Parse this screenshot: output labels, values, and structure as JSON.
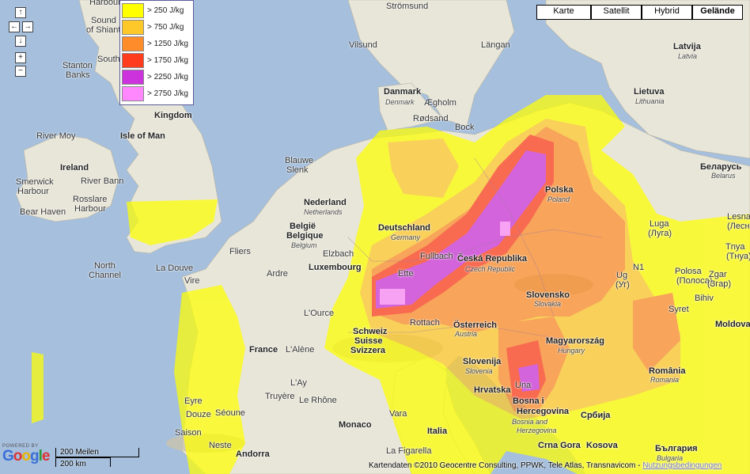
{
  "map_type_buttons": [
    {
      "label": "Karte",
      "active": false
    },
    {
      "label": "Satellit",
      "active": false
    },
    {
      "label": "Hybrid",
      "active": false
    },
    {
      "label": "Gelände",
      "active": true
    }
  ],
  "nav": {
    "up": "↑",
    "left": "←",
    "right": "→",
    "down": "↓",
    "zoom_in": "+",
    "zoom_out": "−"
  },
  "legend": [
    {
      "label": "> 250 J/kg",
      "color": "#ffff00"
    },
    {
      "label": "> 750 J/kg",
      "color": "#ffc82a"
    },
    {
      "label": "> 1250 J/kg",
      "color": "#ff8c2a"
    },
    {
      "label": "> 1750 J/kg",
      "color": "#ff3c1e"
    },
    {
      "label": "> 2250 J/kg",
      "color": "#cc33dd"
    },
    {
      "label": "> 2750 J/kg",
      "color": "#ff88ff"
    }
  ],
  "places": [
    {
      "name": "Harbour",
      "cls": ""
    },
    {
      "name": "Sound",
      "cls": ""
    },
    {
      "name": "of Shiant",
      "cls": ""
    },
    {
      "name": "South",
      "cls": ""
    },
    {
      "name": "Stanton",
      "cls": ""
    },
    {
      "name": "Banks",
      "cls": ""
    },
    {
      "name": "Kingdom",
      "cls": "country"
    },
    {
      "name": "River Moy",
      "cls": ""
    },
    {
      "name": "Isle of Man",
      "cls": "country"
    },
    {
      "name": "Ireland",
      "cls": "country"
    },
    {
      "name": "River Bann",
      "cls": ""
    },
    {
      "name": "Smerwick",
      "cls": ""
    },
    {
      "name": "Harbour",
      "cls": ""
    },
    {
      "name": "Rosslare",
      "cls": ""
    },
    {
      "name": "Harbour",
      "cls": ""
    },
    {
      "name": "Bear Haven",
      "cls": ""
    },
    {
      "name": "North",
      "cls": ""
    },
    {
      "name": "Channel",
      "cls": ""
    },
    {
      "name": "La Douve",
      "cls": ""
    },
    {
      "name": "Vire",
      "cls": ""
    },
    {
      "name": "Fliers",
      "cls": ""
    },
    {
      "name": "Ardre",
      "cls": ""
    },
    {
      "name": "L'Ource",
      "cls": ""
    },
    {
      "name": "France",
      "cls": "country"
    },
    {
      "name": "L'Alène",
      "cls": ""
    },
    {
      "name": "L'Ay",
      "cls": ""
    },
    {
      "name": "Truyère",
      "cls": ""
    },
    {
      "name": "Eyre",
      "cls": ""
    },
    {
      "name": "Douze",
      "cls": ""
    },
    {
      "name": "Séoune",
      "cls": ""
    },
    {
      "name": "Saison",
      "cls": ""
    },
    {
      "name": "Neste",
      "cls": ""
    },
    {
      "name": "Andorra",
      "cls": "country"
    },
    {
      "name": "Le Rhône",
      "cls": ""
    },
    {
      "name": "Monaco",
      "cls": "country"
    },
    {
      "name": "Strömsund",
      "cls": ""
    },
    {
      "name": "Vilsund",
      "cls": ""
    },
    {
      "name": "Längan",
      "cls": ""
    },
    {
      "name": "Danmark",
      "cls": "country"
    },
    {
      "name": "Denmark",
      "cls": "sub"
    },
    {
      "name": "Ægholm",
      "cls": ""
    },
    {
      "name": "Rødsand",
      "cls": ""
    },
    {
      "name": "Bock",
      "cls": ""
    },
    {
      "name": "Blauwe",
      "cls": ""
    },
    {
      "name": "Slenk",
      "cls": ""
    },
    {
      "name": "Nederland",
      "cls": "country"
    },
    {
      "name": "Netherlands",
      "cls": "sub"
    },
    {
      "name": "België",
      "cls": "country"
    },
    {
      "name": "Belgique",
      "cls": "country"
    },
    {
      "name": "Belgium",
      "cls": "sub"
    },
    {
      "name": "Elzbach",
      "cls": ""
    },
    {
      "name": "Luxembourg",
      "cls": "country"
    },
    {
      "name": "Deutschland",
      "cls": "country"
    },
    {
      "name": "Germany",
      "cls": "sub"
    },
    {
      "name": "Fullbach",
      "cls": ""
    },
    {
      "name": "Ette",
      "cls": ""
    },
    {
      "name": "Rottach",
      "cls": ""
    },
    {
      "name": "Schweiz",
      "cls": "country"
    },
    {
      "name": "Suisse",
      "cls": "country"
    },
    {
      "name": "Svizzera",
      "cls": "country"
    },
    {
      "name": "Österreich",
      "cls": "country"
    },
    {
      "name": "Austria",
      "cls": "sub"
    },
    {
      "name": "Česká Republika",
      "cls": "country"
    },
    {
      "name": "Czech Republic",
      "cls": "sub"
    },
    {
      "name": "Polska",
      "cls": "country"
    },
    {
      "name": "Poland",
      "cls": "sub"
    },
    {
      "name": "Slovensko",
      "cls": "country"
    },
    {
      "name": "Slovakia",
      "cls": "sub"
    },
    {
      "name": "Magyarország",
      "cls": "country"
    },
    {
      "name": "Hungary",
      "cls": "sub"
    },
    {
      "name": "Slovenija",
      "cls": "country"
    },
    {
      "name": "Slovenia",
      "cls": "sub"
    },
    {
      "name": "Hrvatska",
      "cls": "country"
    },
    {
      "name": "Una",
      "cls": ""
    },
    {
      "name": "Bosna i",
      "cls": "country"
    },
    {
      "name": "Hercegovina",
      "cls": "country"
    },
    {
      "name": "Bosnia and",
      "cls": "sub"
    },
    {
      "name": "Herzegovina",
      "cls": "sub"
    },
    {
      "name": "Србија",
      "cls": "country"
    },
    {
      "name": "Crna Gora",
      "cls": "country"
    },
    {
      "name": "Kosova",
      "cls": "country"
    },
    {
      "name": "Italia",
      "cls": "country"
    },
    {
      "name": "Vara",
      "cls": ""
    },
    {
      "name": "La Figarella",
      "cls": ""
    },
    {
      "name": "Latvija",
      "cls": "country"
    },
    {
      "name": "Latvia",
      "cls": "sub"
    },
    {
      "name": "Lietuva",
      "cls": "country"
    },
    {
      "name": "Lithuania",
      "cls": "sub"
    },
    {
      "name": "Беларусь",
      "cls": "country"
    },
    {
      "name": "Belarus",
      "cls": "sub"
    },
    {
      "name": "Luga",
      "cls": ""
    },
    {
      "name": "(Луга)",
      "cls": ""
    },
    {
      "name": "Lesna",
      "cls": ""
    },
    {
      "name": "(Лесна)",
      "cls": ""
    },
    {
      "name": "Tnya",
      "cls": ""
    },
    {
      "name": "(Тнуа)",
      "cls": ""
    },
    {
      "name": "Polosa",
      "cls": ""
    },
    {
      "name": "(Полоса)",
      "cls": ""
    },
    {
      "name": "Zgar",
      "cls": ""
    },
    {
      "name": "(Згар)",
      "cls": ""
    },
    {
      "name": "Ug",
      "cls": ""
    },
    {
      "name": "(Уг)",
      "cls": ""
    },
    {
      "name": "N1",
      "cls": ""
    },
    {
      "name": "Bihiv",
      "cls": ""
    },
    {
      "name": "Syret",
      "cls": ""
    },
    {
      "name": "Moldova",
      "cls": "country"
    },
    {
      "name": "România",
      "cls": "country"
    },
    {
      "name": "Romania",
      "cls": "sub"
    },
    {
      "name": "България",
      "cls": "country"
    },
    {
      "name": "Bulgaria",
      "cls": "sub"
    }
  ],
  "scale": {
    "miles": "200 Meilen",
    "km": "200 km"
  },
  "logo": {
    "powered": "POWERED BY",
    "name": "Google"
  },
  "copyright": "Kartendaten ©2010 Geocentre Consulting, PPWK, Tele Atlas, Transnavicom -",
  "terms": "Nutzungsbedingungen"
}
